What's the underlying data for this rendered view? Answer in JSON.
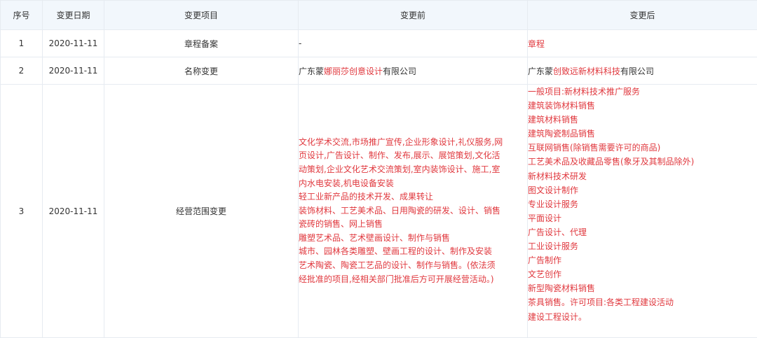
{
  "headers": {
    "seq": "序号",
    "date": "变更日期",
    "item": "变更项目",
    "before": "变更前",
    "after": "变更后"
  },
  "rows": [
    {
      "seq": "1",
      "date": "2020-11-11",
      "item": "章程备案",
      "before": "-",
      "after": "章程"
    },
    {
      "seq": "2",
      "date": "2020-11-11",
      "item": "名称变更",
      "before_parts": [
        "广东蒙",
        "娜丽莎创意设计",
        "有限公司"
      ],
      "after_parts": [
        "广东蒙",
        "创致远新材料科技",
        "有限公司"
      ]
    },
    {
      "seq": "3",
      "date": "2020-11-11",
      "item": "经营范围变更",
      "before_lines": [
        "文化学术交流,市场推广宣传,企业形象设计,礼仪服务,网",
        "页设计,广告设计、制作、发布,展示、展馆策划,文化活",
        "动策划,企业文化艺术交流策划,室内装饰设计、施工,室",
        "内水电安装,机电设备安装",
        "轻工业新产品的技术开发、成果转让",
        "装饰材料、工艺美术品、日用陶瓷的研发、设计、销售",
        "瓷砖的销售、网上销售",
        "雕塑艺术品、艺术壁画设计、制作与销售",
        "城市、园林各类雕塑、壁画工程的设计、制作及安装",
        "艺术陶瓷、陶瓷工艺品的设计、制作与销售。(依法须",
        "经批准的项目,经相关部门批准后方可开展经营活动。)"
      ],
      "after_lines": [
        "一般项目:新材料技术推广服务",
        "建筑装饰材料销售",
        "建筑材料销售",
        "建筑陶瓷制品销售",
        "互联网销售(除销售需要许可的商品)",
        "工艺美术品及收藏品零售(象牙及其制品除外)",
        "新材料技术研发",
        "图文设计制作",
        "专业设计服务",
        "平面设计",
        "广告设计、代理",
        "工业设计服务",
        "广告制作",
        "文艺创作",
        "新型陶瓷材料销售",
        "茶具销售。许可项目:各类工程建设活动",
        "建设工程设计。"
      ]
    }
  ],
  "colors": {
    "highlight": "#e0383e",
    "header_bg": "#f2f7fc",
    "border": "#e6ebf1",
    "text": "#333333"
  }
}
